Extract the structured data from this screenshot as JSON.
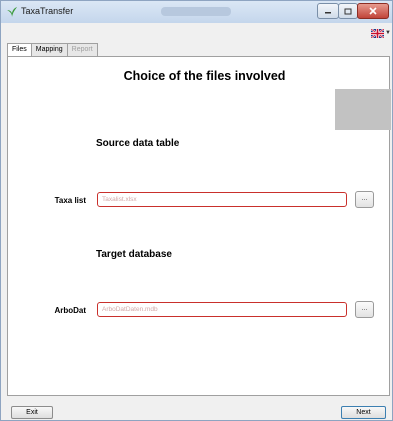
{
  "window": {
    "title": "TaxaTransfer"
  },
  "language": {
    "icon": "uk-flag-icon"
  },
  "tabs": [
    {
      "label": "Files",
      "state": "active"
    },
    {
      "label": "Mapping",
      "state": "normal"
    },
    {
      "label": "Report",
      "state": "disabled"
    }
  ],
  "main": {
    "heading": "Choice of the files involved",
    "source_section": "Source data table",
    "taxa_label": "Taxa list",
    "taxa_placeholder": "Taxalist.xlsx",
    "target_section": "Target database",
    "arbo_label": "ArboDat",
    "arbo_placeholder": "ArboDatDaten.mdb",
    "browse_label": "..."
  },
  "footer": {
    "exit_label": "Exit",
    "next_label": "Next"
  },
  "colors": {
    "input_border": "#c9302c",
    "close_button": "#c1443a"
  }
}
